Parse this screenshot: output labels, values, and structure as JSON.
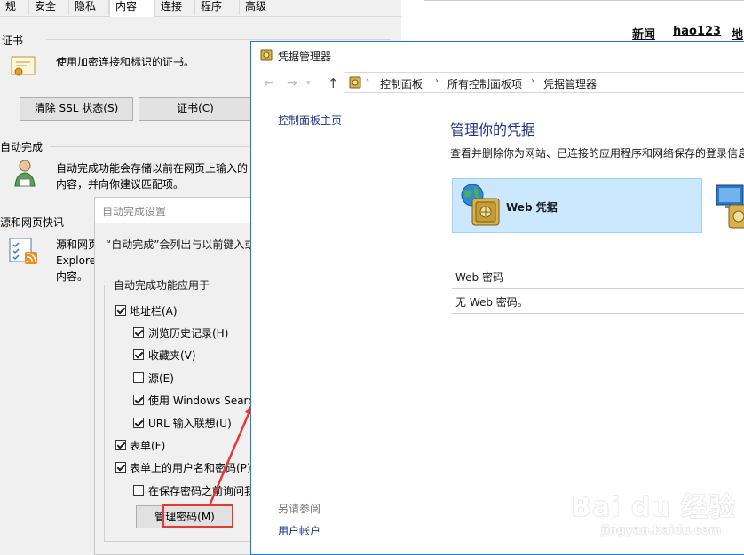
{
  "internet_options": {
    "tabs": [
      "规",
      "安全",
      "隐私",
      "内容",
      "连接",
      "程序",
      "高级"
    ],
    "certificates": {
      "section": "证书",
      "desc": "使用加密连接和标识的证书。",
      "clear_ssl": "清除 SSL 状态(S)",
      "certs": "证书(C)"
    },
    "autocomplete": {
      "section": "自动完成",
      "desc_line1": "自动完成功能会存储以前在网页上输入的",
      "desc_line2": "内容，并向你建议匹配项。"
    },
    "feeds": {
      "section": "源和网页快讯",
      "desc_line1": "源和网页",
      "desc_line2": "Explore",
      "desc_line3": "内容。"
    }
  },
  "browser_page": {
    "links": [
      "新闻",
      "hao123",
      "地"
    ]
  },
  "autocomplete_dialog": {
    "title": "自动完成设置",
    "intro": "“自动完成”会列出与以前键入或",
    "group_label": "自动完成功能应用于",
    "items": [
      {
        "label": "地址栏(A)",
        "checked": true
      },
      {
        "label": "浏览历史记录(H)",
        "checked": true
      },
      {
        "label": "收藏夹(V)",
        "checked": true
      },
      {
        "label": "源(E)",
        "checked": false
      },
      {
        "label": "使用 Windows Searc",
        "checked": true
      },
      {
        "label": "URL 输入联想(U)",
        "checked": true
      },
      {
        "label": "表单(F)",
        "checked": true
      },
      {
        "label": "表单上的用户名和密码(P)",
        "checked": true
      },
      {
        "label": "在保存密码之前询问我",
        "checked": false
      }
    ],
    "manage_passwords": "管理密码(M)"
  },
  "credential_manager": {
    "title": "凭据管理器",
    "breadcrumb": [
      "控制面板",
      "所有控制面板项",
      "凭据管理器"
    ],
    "sidebar_home": "控制面板主页",
    "heading": "管理你的凭据",
    "subtitle": "查看并删除你为网站、已连接的应用程序和网络保存的登录信息",
    "tile_web": "Web 凭据",
    "section_label": "Web 密码",
    "empty_text": "无 Web 密码。",
    "see_also": "另请参阅",
    "user_accounts": "用户帐户"
  },
  "watermark": {
    "logo": "Bai du 经验",
    "url": "jingyan.baidu.com"
  },
  "colors": {
    "accent": "#1e3287",
    "highlight_box": "#e53935",
    "tile_bg": "#cce8ff",
    "window_border": "#1a7bd1"
  }
}
